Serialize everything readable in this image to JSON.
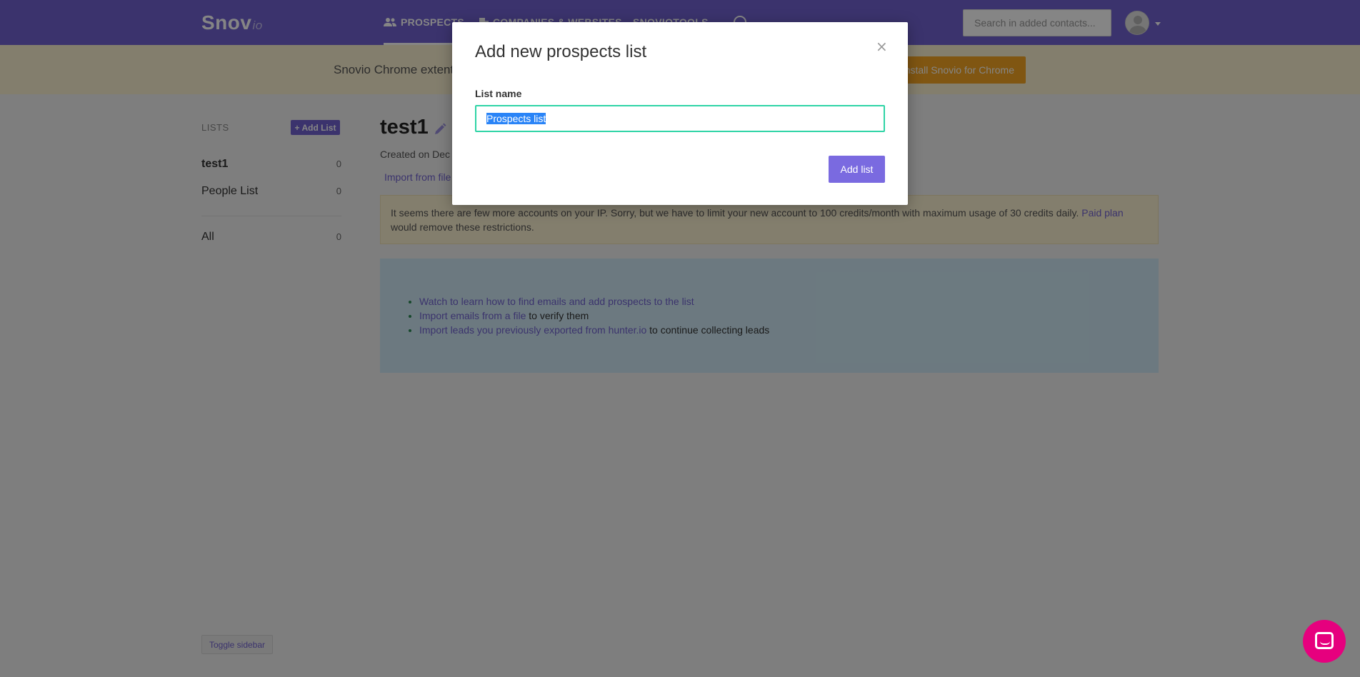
{
  "nav": {
    "logo_main": "Snov",
    "logo_suffix": "io",
    "tab_prospects": "Prospects",
    "tab_companies": "Companies & Websites",
    "tab_tools": "Snoviotools",
    "search_placeholder": "Search in added contacts..."
  },
  "promo": {
    "text": "Snovio Chrome extent",
    "button": "Install Snovio for Chrome"
  },
  "sidebar": {
    "lists_label": "LISTS",
    "add_list_label": "+ Add List",
    "items": [
      {
        "name": "test1",
        "count": "0"
      },
      {
        "name": "People List",
        "count": "0"
      }
    ],
    "all": {
      "name": "All",
      "count": "0"
    },
    "toggle_label": "Toggle sidebar"
  },
  "main": {
    "title": "test1",
    "created": "Created on Dec",
    "import_link": "Import from file",
    "alert_text": "It seems there are few more accounts on your IP. Sorry, but we have to limit your new account to 100 credits/month with maximum usage of 30 credits daily.",
    "alert_link": "Paid plan",
    "alert_tail": "would remove these restrictions.",
    "info": [
      {
        "link": "Watch to learn how to find emails and add prospects to the list",
        "tail": ""
      },
      {
        "link": "Import emails from a file",
        "tail": " to verify them"
      },
      {
        "link": "Import leads you previously exported from hunter.io",
        "tail": " to continue collecting leads"
      }
    ]
  },
  "modal": {
    "title": "Add new prospects list",
    "close_label": "×",
    "field_label": "List name",
    "input_value": "Prospects list",
    "submit_label": "Add list"
  },
  "colors": {
    "brand": "#7263d1",
    "promo_bg": "#fcf1d1",
    "promo_button": "#f5a623",
    "input_focus": "#2fd4a6",
    "chat": "#e6007e"
  }
}
